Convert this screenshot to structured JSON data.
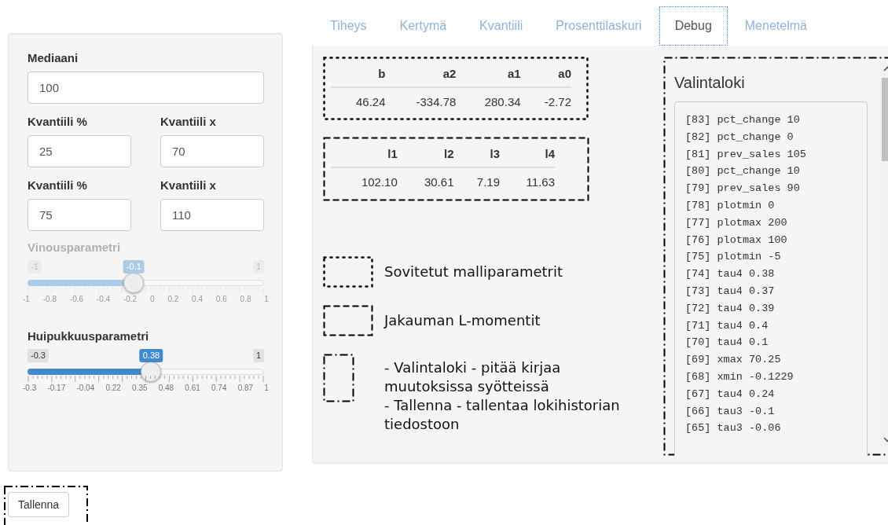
{
  "tabs": [
    {
      "label": "Tiheys",
      "selected": false
    },
    {
      "label": "Kertymä",
      "selected": false
    },
    {
      "label": "Kvantiili",
      "selected": false
    },
    {
      "label": "Prosenttilaskuri",
      "selected": false
    },
    {
      "label": "Debug",
      "selected": true
    },
    {
      "label": "Menetelmä",
      "selected": false
    }
  ],
  "sidebar": {
    "median": {
      "label": "Mediaani",
      "value": "100"
    },
    "quantile_rows": [
      {
        "pct_label": "Kvantiili %",
        "pct_value": "25",
        "x_label": "Kvantiili x",
        "x_value": "70"
      },
      {
        "pct_label": "Kvantiili %",
        "pct_value": "75",
        "x_label": "Kvantiili x",
        "x_value": "110"
      }
    ],
    "sliders": [
      {
        "label": "Vinousparametri",
        "disabled": true,
        "min": "-1",
        "max": "1",
        "value": "-0.1",
        "level": 0.45,
        "ticks": [
          "-1",
          "-0.8",
          "-0.6",
          "-0.4",
          "-0.2",
          "0",
          "0.2",
          "0.4",
          "0.6",
          "0.8",
          "1"
        ]
      },
      {
        "label": "Huipukkuusparametri",
        "disabled": false,
        "min": "-0.3",
        "max": "1",
        "value": "0.38",
        "level": 0.523,
        "ticks": [
          "-0.3",
          "-0.17",
          "-0.04",
          "0.22",
          "0.35",
          "0.48",
          "0.61",
          "0.74",
          "0.87",
          "1"
        ]
      }
    ]
  },
  "save_button": {
    "label": "Tallenna"
  },
  "param_table": {
    "columns": [
      "b",
      "a2",
      "a1",
      "a0"
    ],
    "rows": [
      [
        "46.24",
        "-334.78",
        "280.34",
        "-2.72"
      ]
    ]
  },
  "lmoment_table": {
    "columns": [
      "l1",
      "l2",
      "l3",
      "l4"
    ],
    "rows": [
      [
        "102.10",
        "30.61",
        "7.19",
        "11.63"
      ]
    ]
  },
  "legend": [
    {
      "kind": "dotted",
      "text": "Sovitetut malliparametrit"
    },
    {
      "kind": "dashed",
      "text": "Jakauman L-momentit"
    },
    {
      "kind": "dashdot",
      "text": "- Valintaloki - pitää kirjaa muutoksissa syötteissä\n- Tallenna - tallentaa lokihistorian tiedostoon"
    }
  ],
  "log": {
    "title": "Valintaloki",
    "entries": [
      "[83] pct_change 10",
      "[82] pct_change 0",
      "[81] prev_sales 105",
      "[80] pct_change 10",
      "[79] prev_sales 90",
      "[78] plotmin 0",
      "[77] plotmax 200",
      "[76] plotmax 100",
      "[75] plotmin -5",
      "[74] tau4 0.38",
      "[73] tau4 0.37",
      "[72] tau4 0.39",
      "[71] tau4 0.4",
      "[70] tau4 0.1",
      "[69] xmax 70.25",
      "[68] xmin -0.1229",
      "[67] tau4 0.24",
      "[66] tau3 -0.1",
      "[65] tau3 -0.06"
    ]
  }
}
